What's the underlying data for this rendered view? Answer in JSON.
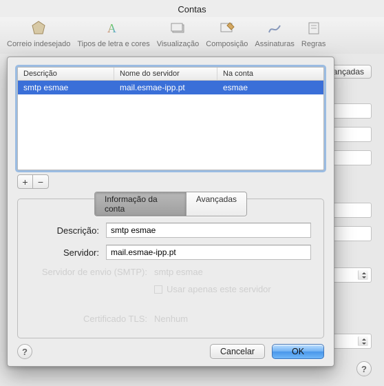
{
  "window": {
    "title": "Contas"
  },
  "toolbar": {
    "items": [
      {
        "label": "Correio indesejado"
      },
      {
        "label": "Tipos de letra e cores"
      },
      {
        "label": "Visualização"
      },
      {
        "label": "Composição"
      },
      {
        "label": "Assinaturas"
      },
      {
        "label": "Regras"
      }
    ]
  },
  "background": {
    "tab": "Avançadas"
  },
  "sheet": {
    "columns": {
      "a": "Descrição",
      "b": "Nome do servidor",
      "c": "Na conta"
    },
    "row": {
      "a": "smtp esmae",
      "b": "mail.esmae-ipp.pt",
      "c": "esmae"
    },
    "add": "+",
    "remove": "−",
    "tabs": {
      "info": "Informação da conta",
      "adv": "Avançadas"
    },
    "form": {
      "desc_label": "Descrição:",
      "desc_value": "smtp esmae",
      "serv_label": "Servidor:",
      "serv_value": "mail.esmae-ipp.pt"
    },
    "ghost": {
      "smtp_label": "Servidor de envio (SMTP):",
      "smtp_value": "smtp esmae",
      "only": "Usar apenas este servidor",
      "tls_label": "Certificado TLS:",
      "tls_value": "Nenhum"
    },
    "buttons": {
      "cancel": "Cancelar",
      "ok": "OK"
    },
    "help": "?"
  }
}
